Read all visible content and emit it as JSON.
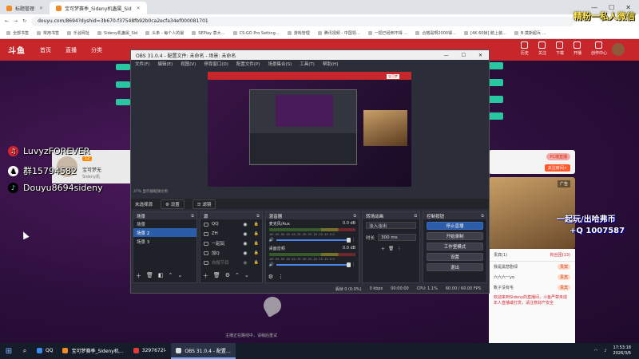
{
  "browser": {
    "tabs": [
      {
        "label": "标题管理",
        "active": false
      },
      {
        "label": "宝可梦赛季_Sideny机蛊属_Sid",
        "active": true
      }
    ],
    "url": "douyu.com/8694?dyshid=3b670-f37548fb92b0ca2ecfa34ef000081701",
    "bookmarks": [
      "全部书签",
      "常用书签",
      "乐谷网址",
      "Sideny机蛊属_Sid",
      "头条 - 每个人的最",
      "SEPlay 意大…",
      "CS:GO Pro Setting…",
      "游戏管理",
      "腾讯视频 - 中国领…",
      "一把已经倒不得 …",
      "合格是啊2000得…",
      "[4K 60帧] 鹅上装…",
      "B·莫斯超兵 …"
    ]
  },
  "site": {
    "logo": "斗鱼",
    "nav": [
      "首页",
      "直播",
      "分类"
    ],
    "right_icons": [
      "历史",
      "关注",
      "下载",
      "开播",
      "创作中心"
    ]
  },
  "streamer_card": {
    "level": "12",
    "name": "宝可梦无",
    "sub": "Sideny机"
  },
  "right_panel": {
    "pc_badge": "PC端直播",
    "follow": "关注房间+"
  },
  "ad": {
    "label": "广告"
  },
  "chat": {
    "tabs": [
      "贵宾(1)",
      "粉丝团(13)"
    ],
    "lines": [
      {
        "name": "我是黑悲剧绿",
        "badge": "贵宾"
      },
      {
        "name": "六六六一yo",
        "badge": "贵宾"
      },
      {
        "name": "靴子没有毛",
        "badge": "贵宾"
      }
    ],
    "notice": "欢迎来到Sideny的直播间，斗鱼严禁未成年人直播或打赏，请注意财产安全"
  },
  "overlays": {
    "netease": "LuvyzFOREVER",
    "qq": "群15794582",
    "douyin": "Douyu8694sideny",
    "watermark": "精粉一私人微信",
    "promo1": "一起玩/出哈弗币",
    "promo2": "+Q 1007587"
  },
  "obs": {
    "title": "OBS 31.0.4 - 配置文件: 未命名 - 场景: 未命名",
    "window_ctrls": [
      "—",
      "☐",
      "✕"
    ],
    "menu": [
      "文件(F)",
      "编辑(E)",
      "视图(V)",
      "停靠窗口(D)",
      "配置文件(P)",
      "场景集合(S)",
      "工具(T)",
      "帮助(H)"
    ],
    "preview_banner": "宝可梦",
    "preview_label": "37% 显示器缩放比例",
    "toolbar": {
      "no_source": "未选择源",
      "settings": "设置",
      "filters": "滤镜"
    },
    "panels": {
      "scenes": {
        "title": "场景",
        "items": [
          "场景",
          "场景 2",
          "场景 3"
        ],
        "selected": 1
      },
      "sources": {
        "title": "源",
        "items": [
          "QQ",
          "ZH",
          "一起玩",
          "加Q",
          "自报节目"
        ]
      },
      "mixer": {
        "title": "混音器",
        "tracks": [
          {
            "name": "麦克风/Aux",
            "db": "0.0 dB"
          },
          {
            "name": "桌面音频",
            "db": "0.0 dB"
          }
        ],
        "ticks": "-60 -55 -50 -45 -40 -35 -30 -25 -20 -15 -10 -5 0"
      },
      "transitions": {
        "title": "转场动画",
        "type": "淡入淡出",
        "duration_label": "时长",
        "duration": "300 ms"
      },
      "controls": {
        "title": "控制按钮",
        "buttons": [
          "停止直播",
          "开始录制",
          "工作室模式",
          "设置",
          "退出"
        ]
      }
    },
    "status": {
      "dropped": "丢帧 0 (0.0%)",
      "kbps": "0 kbps",
      "time": "00:00:00",
      "cpu": "CPU: 1.1%",
      "fps": "60.00 / 60.00 FPS"
    }
  },
  "video_hint": "主播正在路线中，请稍后重试",
  "taskbar": {
    "items": [
      {
        "label": "QQ",
        "active": false,
        "color": "#3b8beb"
      },
      {
        "label": "宝可梦赛季_Sideny机…",
        "active": false,
        "color": "#f08a24"
      },
      {
        "label": "3297672l-",
        "active": false,
        "color": "#e03a3a"
      },
      {
        "label": "OBS 31.0.4 - 配置…",
        "active": true,
        "color": "#ddd"
      }
    ],
    "time": "17:53:18",
    "date": "2026/3/6"
  }
}
